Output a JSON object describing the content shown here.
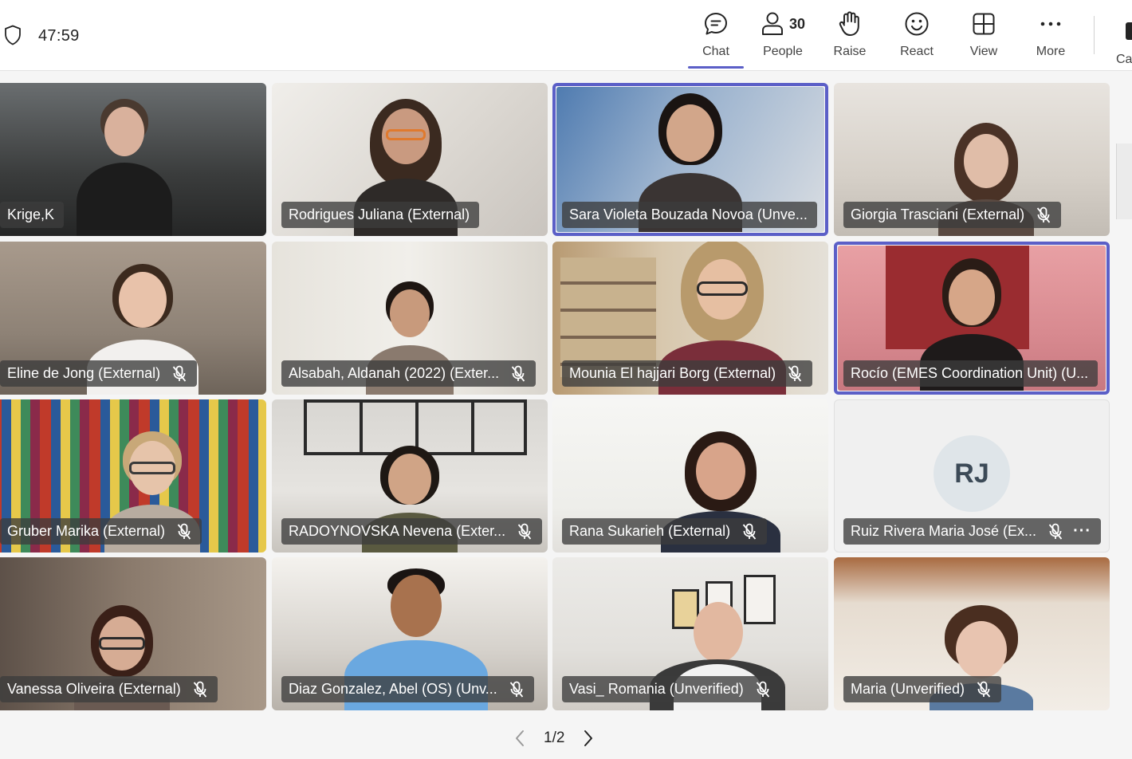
{
  "meeting": {
    "timer": "47:59"
  },
  "toolbar": {
    "chat": "Chat",
    "people": "People",
    "people_count": "30",
    "raise": "Raise",
    "react": "React",
    "view": "View",
    "more": "More",
    "camera_partial": "Ca"
  },
  "participants": [
    {
      "name": "Krige,K",
      "muted": false
    },
    {
      "name": "Rodrigues Juliana (External)",
      "muted": false
    },
    {
      "name": "Sara Violeta Bouzada Novoa (Unve...",
      "muted": false,
      "speaking": true
    },
    {
      "name": "Giorgia Trasciani (External)",
      "muted": true
    },
    {
      "name": "Eline de Jong (External)",
      "muted": true
    },
    {
      "name": "Alsabah, Aldanah (2022) (Exter...",
      "muted": true
    },
    {
      "name": "Mounia El hajjari Borg (External)",
      "muted": true
    },
    {
      "name": "Rocío (EMES Coordination Unit) (U...",
      "muted": false,
      "speaking": true
    },
    {
      "name": "Gruber Marika (External)",
      "muted": true
    },
    {
      "name": "RADOYNOVSKA Nevena (Exter...",
      "muted": true
    },
    {
      "name": "Rana Sukarieh (External)",
      "muted": true
    },
    {
      "name": "Ruiz Rivera Maria José (Ex...",
      "muted": true,
      "initials": "RJ",
      "video_off": true
    },
    {
      "name": "Vanessa Oliveira (External)",
      "muted": true
    },
    {
      "name": "Diaz Gonzalez, Abel (OS) (Unv...",
      "muted": true
    },
    {
      "name": "Vasi_ Romania (Unverified)",
      "muted": true
    },
    {
      "name": "Maria (Unverified)",
      "muted": true
    }
  ],
  "pagination": {
    "label": "1/2"
  },
  "colors": {
    "accent": "#5b5fc7",
    "nameplate": "#3c3c3c"
  }
}
